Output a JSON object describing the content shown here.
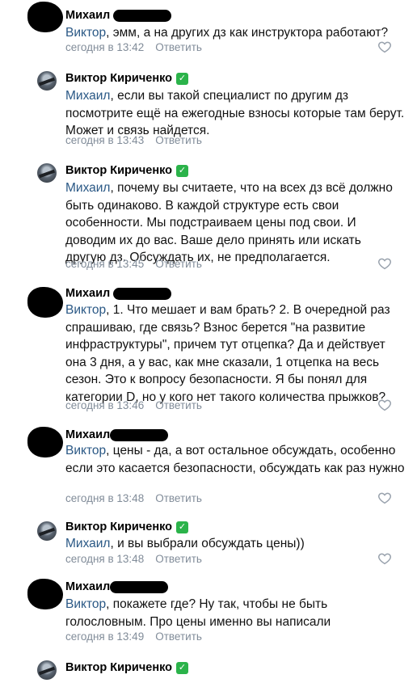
{
  "comments": [
    {
      "author": "Михаил",
      "censored": true,
      "mention": "Виктор",
      "text": ", эмм, а на других дз как инструктора работают?",
      "time": "сегодня в 13:42",
      "reply": "Ответить"
    },
    {
      "author": "Виктор Кириченко",
      "verified": "✓",
      "mention": "Михаил",
      "text": ", если вы такой специалист по другим дз посмотрите ещё на ежегодные взносы которые там берут. Может и связь найдется.",
      "time": "сегодня в 13:43",
      "reply": "Ответить"
    },
    {
      "author": "Виктор Кириченко",
      "verified": "✓",
      "mention": "Михаил",
      "text": ", почему вы считаете, что на всех дз всё должно быть одинаково. В каждой структуре есть свои особенности. Мы подстраиваем цены под свои. И доводим их до вас. Ваше дело принять или искать другую дз. Обсуждать их, не предполагается.",
      "time": "сегодня в 13:45",
      "reply": "Ответить"
    },
    {
      "author": "Михаил",
      "censored": true,
      "mention": "Виктор",
      "text": ", 1. Что мешает и вам брать? 2. В очередной раз спрашиваю, где связь? Взнос берется \"на развитие инфраструктуры\", причем тут отцепка? Да и действует она 3 дня, а у вас, как мне сказали, 1 отцепка на весь сезон. Это к вопросу безопасности. Я бы понял для категории D, но у кого нет такого количества прыжков?",
      "time": "сегодня в 13:46",
      "reply": "Ответить"
    },
    {
      "author": "Михаил",
      "censored": true,
      "mention": "Виктор",
      "text": ", цены - да, а вот остальное обсуждать, особенно если это касается безопасности, обсуждать как раз нужно",
      "time": "сегодня в 13:48",
      "reply": "Ответить"
    },
    {
      "author": "Виктор Кириченко",
      "verified": "✓",
      "mention": "Михаил",
      "text": ", и вы выбрали обсуждать цены))",
      "time": "сегодня в 13:48",
      "reply": "Ответить"
    },
    {
      "author": "Михаил",
      "censored": true,
      "mention": "Виктор",
      "text": ", покажете где? Ну так, чтобы не быть голословным. Про цены именно вы написали",
      "time": "сегодня в 13:49",
      "reply": "Ответить"
    },
    {
      "author": "Виктор Кириченко",
      "verified": "✓"
    }
  ],
  "colors": {
    "mention": "#2a5885",
    "meta": "#818c99",
    "verified": "#2bb34a"
  }
}
